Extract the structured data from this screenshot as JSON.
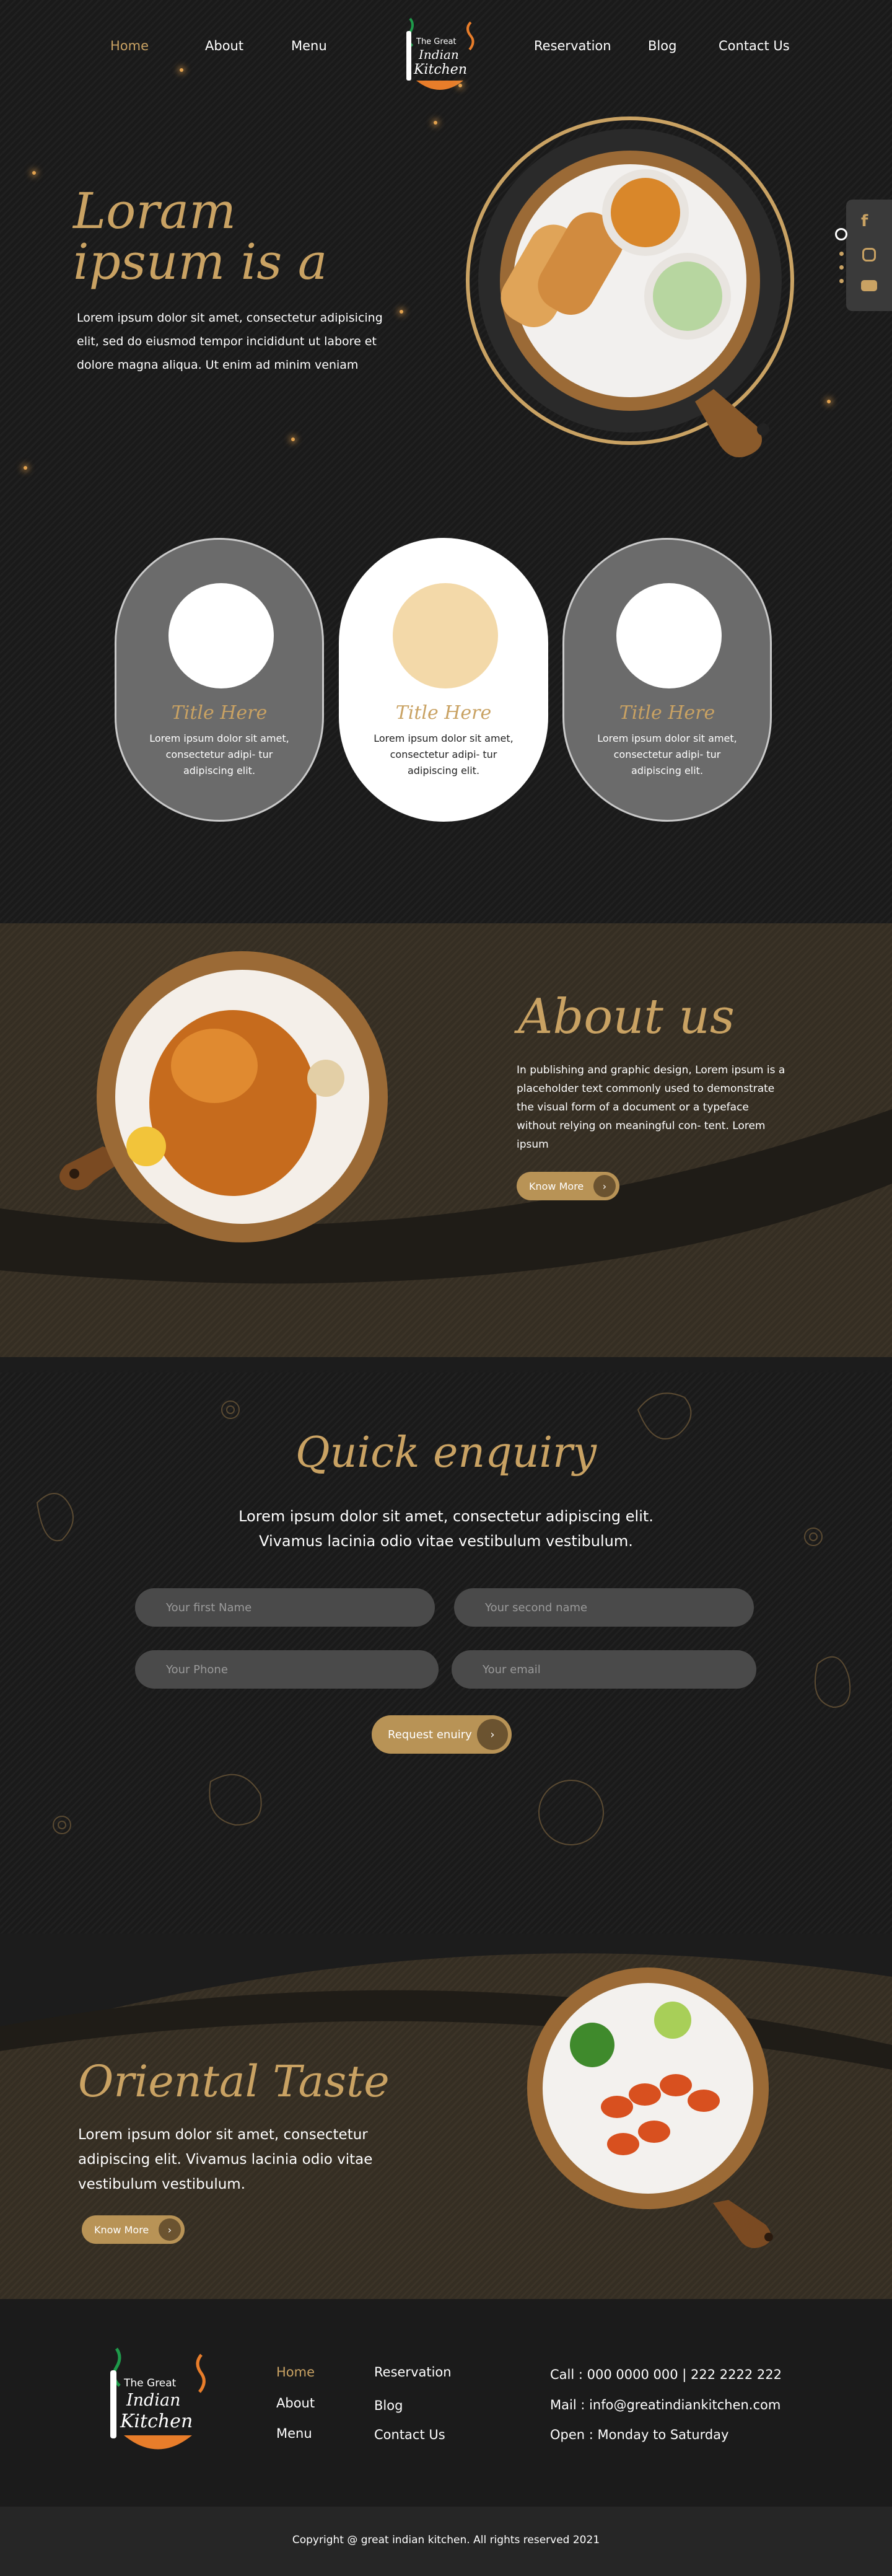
{
  "nav": {
    "items": [
      "Home",
      "About",
      "Menu",
      "Reservation",
      "Blog",
      "Contact Us"
    ],
    "active": "Home",
    "logo": {
      "line1": "The Great",
      "line2": "Indian",
      "line3": "Kitchen"
    }
  },
  "social": {
    "icons": [
      "facebook-icon",
      "instagram-icon",
      "youtube-icon"
    ]
  },
  "hero": {
    "title_line1": "Loram",
    "title_line2": "ipsum is a",
    "body": "Lorem ipsum dolor sit amet, consectetur adipisicing elit, sed do eiusmod tempor incididunt ut labore et dolore magna aliqua. Ut enim ad minim veniam"
  },
  "cards": [
    {
      "title": "Title Here",
      "body": "Lorem ipsum dolor sit amet, consectetur adipi- tur adipiscing elit."
    },
    {
      "title": "Title Here",
      "body": "Lorem ipsum dolor sit amet, consectetur adipi- tur adipiscing elit."
    },
    {
      "title": "Title Here",
      "body": "Lorem ipsum dolor sit amet, consectetur adipi- tur adipiscing elit."
    }
  ],
  "about": {
    "title": "About us",
    "body": "In publishing and graphic design, Lorem ipsum is a placeholder text commonly used to demonstrate the visual form of a document or a typeface without relying on meaningful con- tent. Lorem ipsum",
    "button": "Know More"
  },
  "enquiry": {
    "title": "Quick enquiry",
    "subtitle": "Lorem ipsum dolor sit amet, consectetur adipiscing elit. Vivamus lacinia odio vitae vestibulum vestibulum.",
    "fields": {
      "first": "Your first Name",
      "second": "Your second name",
      "phone": "Your Phone",
      "email": "Your email"
    },
    "button": "Request enuiry"
  },
  "oriental": {
    "title": "Oriental Taste",
    "body": "Lorem ipsum dolor sit amet, consectetur adipiscing elit. Vivamus lacinia odio vitae vestibulum vestibulum.",
    "button": "Know More"
  },
  "footer": {
    "links_col1": [
      "Home",
      "About",
      "Menu"
    ],
    "links_col2": [
      "Reservation",
      "Blog",
      "Contact Us"
    ],
    "call": "Call : 000 0000 000 | 222 2222 222",
    "mail": "Mail : info@greatindiankitchen.com",
    "open": "Open : Monday to Saturday",
    "logo": {
      "line1": "The Great",
      "line2": "Indian",
      "line3": "Kitchen"
    }
  },
  "copyright": "Copyright @ great indian kitchen. All rights reserved 2021",
  "colors": {
    "accent": "#c9a263",
    "dark": "#1c1c1c",
    "brown": "#3b3327"
  }
}
